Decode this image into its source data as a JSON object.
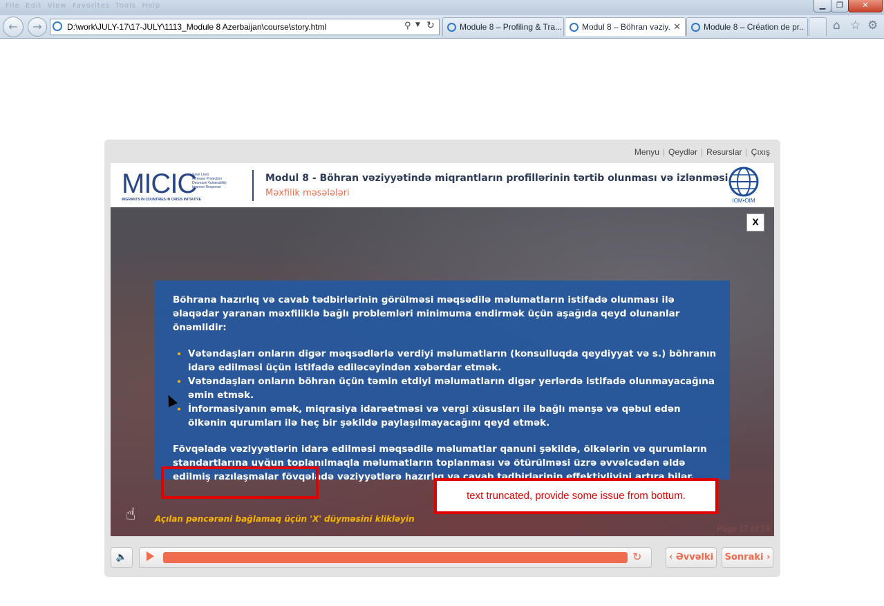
{
  "browser": {
    "window_controls": {
      "minimize": "▁",
      "maximize": "❐",
      "close": "✕"
    },
    "address": "D:\\work\\JULY-17\\17-JULY\\1113_Module 8 Azerbaijan\\course\\story.html",
    "tabs": [
      {
        "label": "Module 8 – Profiling & Tra...",
        "active": false
      },
      {
        "label": "Modul 8 – Böhran vəziy...",
        "active": true
      },
      {
        "label": "Module 8 – Création de pr...",
        "active": false
      }
    ],
    "tab_close": "✕",
    "icons": {
      "back": "back-arrow-icon",
      "forward": "forward-arrow-icon",
      "home": "home-icon",
      "favorites": "star-icon",
      "tools": "gear-icon"
    }
  },
  "player": {
    "top_links": [
      "Menyu",
      "Qeydlər",
      "Resurslar",
      "Çıxış"
    ],
    "header": {
      "logo_text": "MICIC",
      "logo_tagline": [
        "Save Lives",
        "Increase Protection",
        "Decrease Vulnerability",
        "Improve Response"
      ],
      "logo_subtitle": "MIGRANTS IN COUNTRIES IN CRISIS INITIATIVE",
      "module_title": "Modul 8 - Böhran vəziyyətində miqrantların profillərinin tərtib olunması və izlənməsi",
      "module_subtitle": "Məxfilik məsələləri",
      "partner_logo_label": "IOM•OIM"
    },
    "slide": {
      "close_label": "X",
      "intro": "Böhrana hazırlıq və cavab tədbirlərinin görülməsi məqsədilə məlumatların istifadə olunması ilə əlaqədar yaranan məxfiliklə bağlı problemləri minimuma endirmək üçün aşağıda qeyd olunanlar önəmlidir:",
      "bullets": [
        "Vətəndaşları onların digər məqsədlərlə verdiyi məlumatların (konsulluqda qeydiyyat və s.) böhranın idarə edilməsi üçün istifadə ediləcəyindən xəbərdar etmək.",
        "Vətəndaşları onların böhran üçün təmin etdiyi məlumatların digər yerlərdə istifadə olunmayacağına əmin etmək.",
        "İnformasiyanın əmək, miqrasiya idarəetməsi və vergi xüsusları ilə bağlı mənşə və qəbul edən ölkənin qurumları ilə  heç bir şəkildə paylaşılmayacağını qeyd etmək."
      ],
      "closing": "Fövqəladə vəziyyətlərin idarə edilməsi məqsədilə məlumatlar qanuni şəkildə, ölkələrin və qurumların standartlarına uyğun toplanılmaqla məlumatların toplanması və ötürülməsi üzrə əvvəlcədən əldə edilmiş razılaşmalar fövqəladə vəziyyətlərə hazırlıq və cavab tədbirlərinin effektivliyini artıra bilər.",
      "hint": "Açılan pəncərəni bağlamaq üçün  'X' düyməsini klikləyin",
      "page_counter": "Page 17 of 19"
    },
    "annotation_note": "text truncated, provide some issue from bottum.",
    "controls": {
      "volume_icon": "speaker-icon",
      "progress_percent": 100,
      "prev_label": "Əvvəlki",
      "next_label": "Sonraki",
      "prev_glyph": "‹",
      "next_glyph": "›",
      "replay_glyph": "↻"
    },
    "accent_color": "#ef6c4e",
    "panel_color": "#25589f",
    "bullet_color": "#f5b400"
  }
}
